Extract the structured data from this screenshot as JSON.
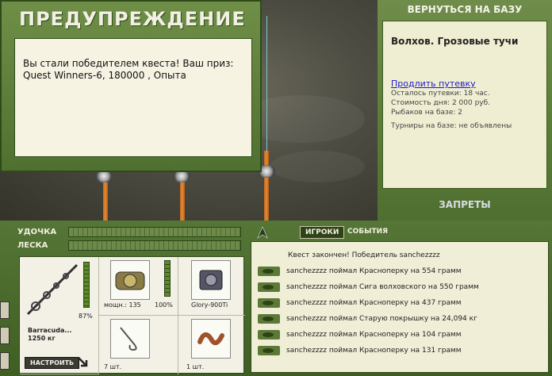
{
  "warning": {
    "title": "ПРЕДУПРЕЖДЕНИЕ",
    "message_line1": "Вы стали победителем квеста! Ваш приз:",
    "message_line2": "Quest Winners-6, 180000 , Опыта"
  },
  "right_panel": {
    "return_button": "ВЕРНУТЬСЯ НА БАЗУ",
    "location": "Волхов. Грозовые тучи",
    "extend_link": "Продлить путевку",
    "remaining": "Осталось путевки: 18 час.",
    "day_cost": "Стоимость дня: 2 000 руб.",
    "anglers": "Рыбаков на базе: 2",
    "tournaments": "Турниры на базе: не объявлены",
    "bans_button": "ЗАПРЕТЫ"
  },
  "gear": {
    "rod_label": "УДОЧКА",
    "line_label": "ЛЕСКА",
    "rod_name": "Barracuda...",
    "rod_weight": "1250 кг",
    "rod_percent": "87%",
    "tune_button": "НАСТРОИТЬ",
    "reel_power": "мощн.: 135",
    "reel_percent": "100%",
    "line_name": "Glory-900Ti",
    "hook_count": "7 шт.",
    "bait_count": "1 шт.",
    "rod_durability": 0.87,
    "reel_durability": 1.0
  },
  "events": {
    "tabs": [
      "ИГРОКИ",
      "СОБЫТИЯ"
    ],
    "header": "Квест закончен! Победитель sanchezzzz",
    "rows": [
      "sanchezzzz поймал Красноперку на 554 грамм",
      "sanchezzzz поймал Сига волховского на 550 грамм",
      "sanchezzzz поймал Красноперку на 437 грамм",
      "sanchezzzz поймал Старую покрышку на 24,094 кг",
      "sanchezzzz поймал Красноперку на 104 грамм",
      "sanchezzzz поймал Красноперку на 131 грамм"
    ]
  }
}
